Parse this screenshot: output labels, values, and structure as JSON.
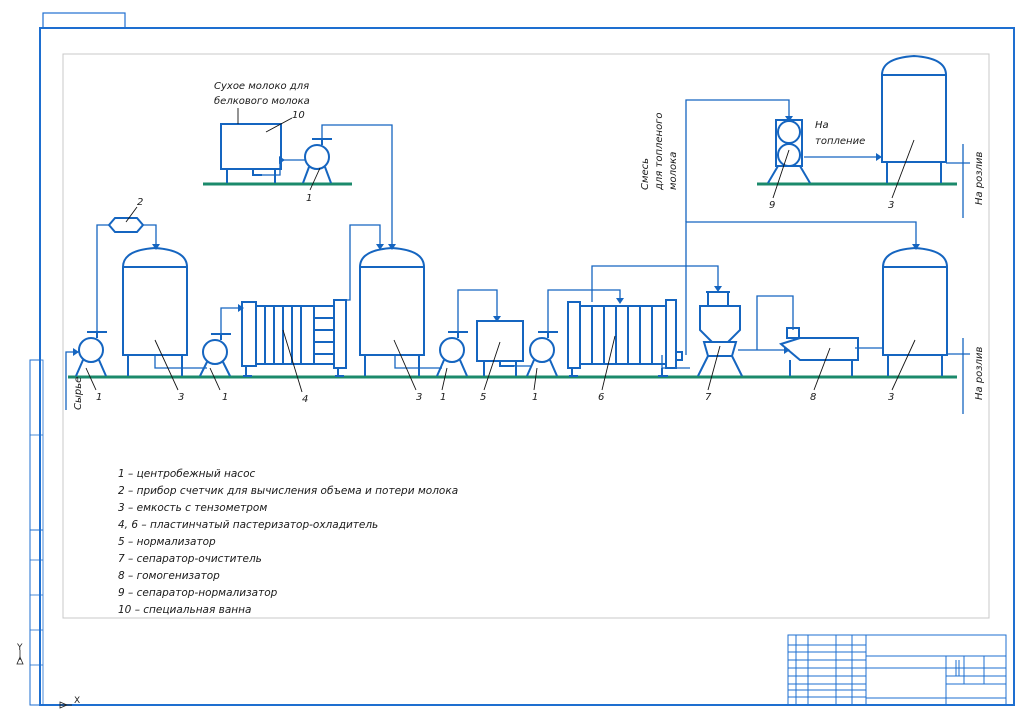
{
  "side_labels": {
    "raw": "Сырье",
    "bottling_top": "На розлив",
    "bottling_bottom": "На розлив",
    "baked_mix": [
      "Смесь",
      "для топленого",
      "молока"
    ],
    "to_baking": [
      "На",
      "топление"
    ],
    "dry_milk": [
      "Сухое молоко для",
      "белкового молока"
    ]
  },
  "markers": {
    "m1a": "1",
    "m2": "2",
    "m3a": "3",
    "m1b": "1",
    "m4": "4",
    "m3b": "3",
    "m1c": "1",
    "m5": "5",
    "m1d": "1",
    "m6": "6",
    "m7": "7",
    "m8": "8",
    "m3c": "3",
    "m10": "10",
    "m1e": "1",
    "m9": "9",
    "m3d": "3"
  },
  "legend": [
    "1 – центробежный насос",
    "2 – прибор счетчик для вычисления объема и потери молока",
    "3 – емкость с тензометром",
    "4, 6 – пластинчатый пастеризатор-охладитель",
    "5 – нормализатор",
    "7 – сепаратор-очиститель",
    "8 – гомогенизатор",
    "9 – сепаратор-нормализатор",
    "10 – специальная ванна"
  ],
  "axes": {
    "y": "Y",
    "x": "X"
  },
  "colors": {
    "lines": "#1565c0",
    "frame": "#1e6fd0",
    "floor": "#1b8a6b"
  }
}
